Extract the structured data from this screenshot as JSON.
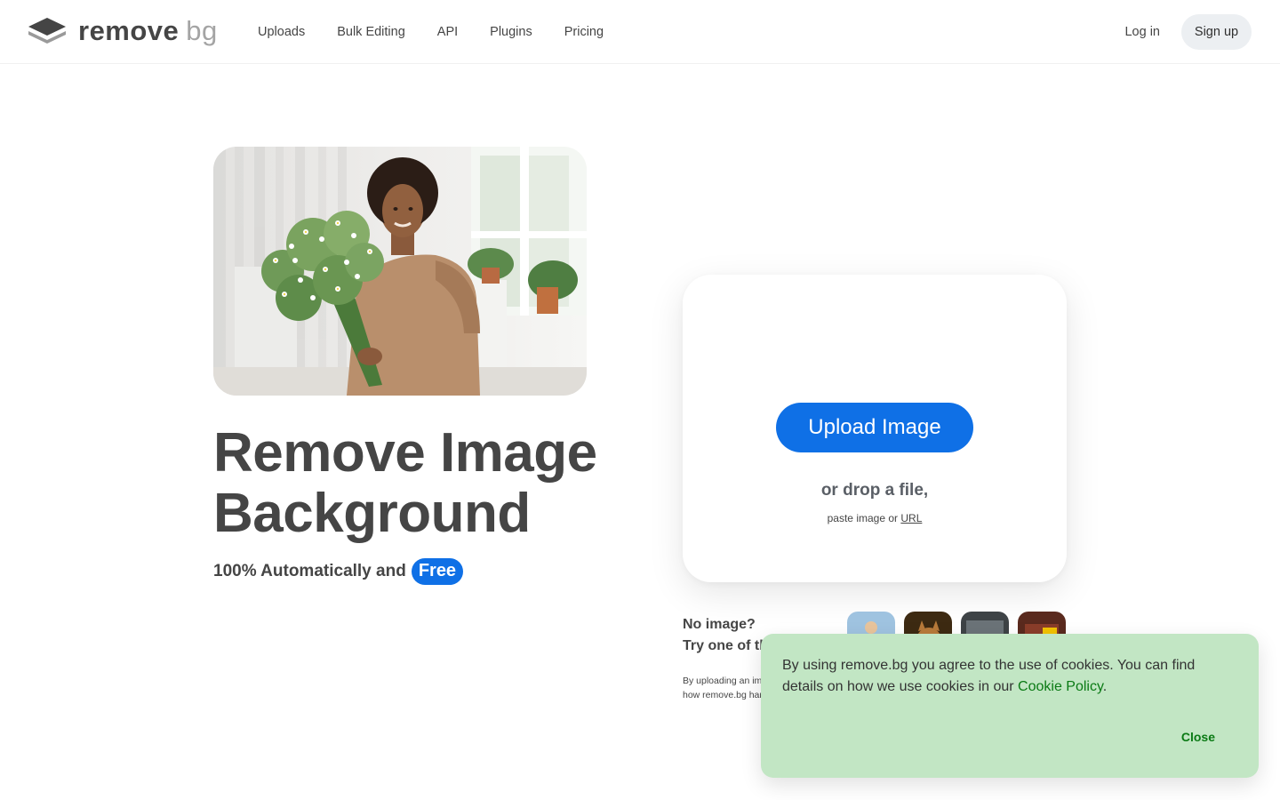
{
  "header": {
    "logo": {
      "word_main": "remove",
      "word_accent": "bg"
    },
    "nav": [
      {
        "label": "Uploads"
      },
      {
        "label": "Bulk Editing"
      },
      {
        "label": "API"
      },
      {
        "label": "Plugins"
      },
      {
        "label": "Pricing"
      }
    ],
    "login_label": "Log in",
    "signup_label": "Sign up"
  },
  "hero": {
    "photo_icon": "woman-with-flower-bouquet-photo",
    "title": "Remove Image Background",
    "subtitle": "100% Automatically and",
    "badge": "Free"
  },
  "upload": {
    "button_label": "Upload Image",
    "drop_text": "or drop a file,",
    "paste_text": "paste image or",
    "url_label": "URL"
  },
  "samples": {
    "prompt_line1": "No image?",
    "prompt_line2": "Try one of these:",
    "items": [
      {
        "icon": "sample-person-thumbnail"
      },
      {
        "icon": "sample-cat-thumbnail"
      },
      {
        "icon": "sample-car-thumbnail"
      },
      {
        "icon": "sample-object-thumbnail"
      }
    ],
    "terms_line1": "By uploading an image you agree to our Terms of Service.",
    "terms_line2": "how remove.bg handles your personal data, see our Privacy Policy."
  },
  "cookie": {
    "text": "By using remove.bg you agree to the use of cookies. You can find details on how we use cookies in our",
    "link_label": "Cookie Policy",
    "period": ".",
    "close_label": "Close"
  },
  "colors": {
    "accent": "#0f70e6",
    "text": "#454545",
    "cookie_bg": "#c2e6c4",
    "cookie_link": "#0a7a14"
  }
}
